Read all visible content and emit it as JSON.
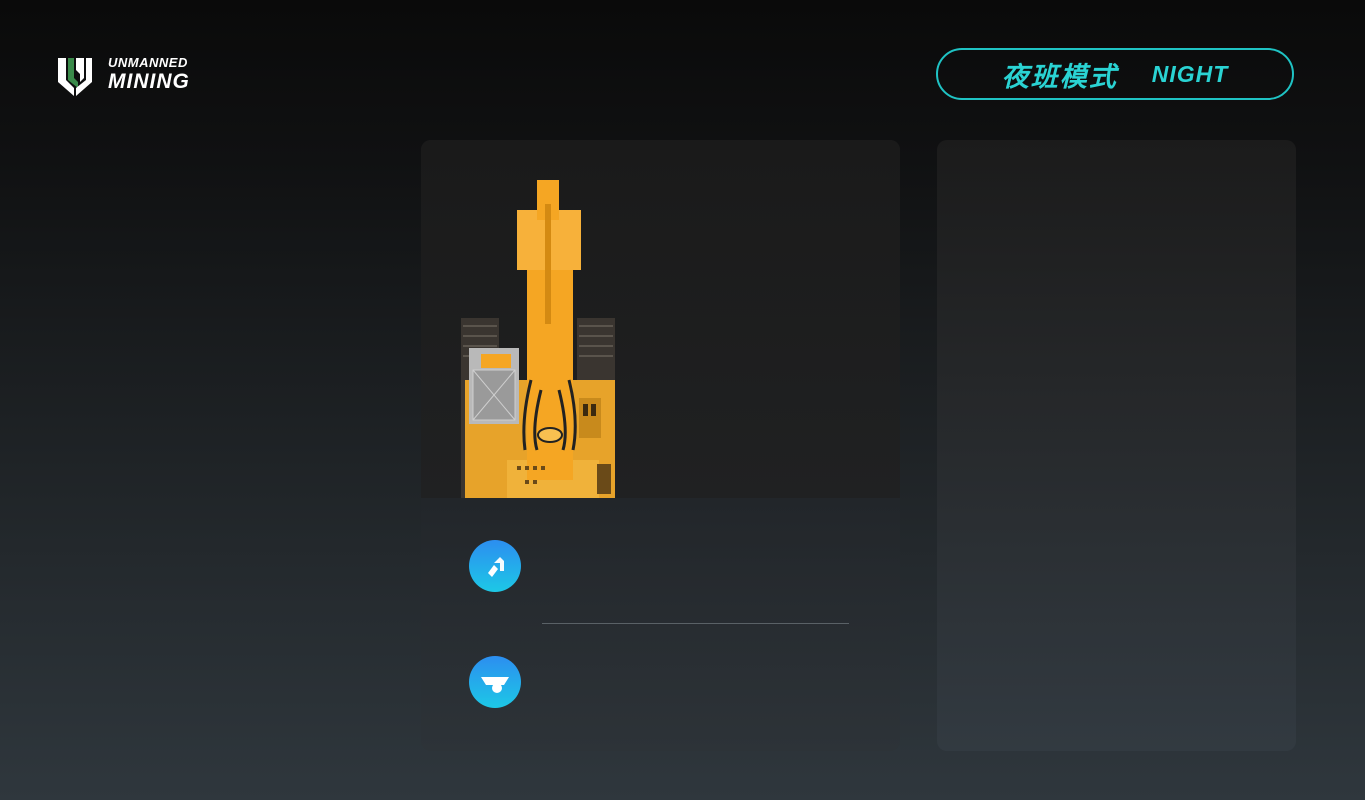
{
  "brand": {
    "line1": "UNMANNED",
    "line2": "MINING",
    "logo_icon": "unmanned-mining-logo",
    "logo_color": "#ffffff",
    "logo_accent": "#3a8a4a"
  },
  "mode": {
    "label_zh": "夜班模式",
    "label_en": "NIGHT",
    "accent": "#1fc3c4"
  },
  "main_panel": {
    "vehicle_image": "yellow-excavator-top-view",
    "vehicle_color": "#f5a623",
    "rows": [
      {
        "icon": "excavator-bucket-icon",
        "value": ""
      },
      {
        "icon": "dump-truck-icon",
        "value": ""
      }
    ],
    "icon_gradient": [
      "#2c8ef0",
      "#1dc8e6"
    ]
  },
  "side_panel": {}
}
